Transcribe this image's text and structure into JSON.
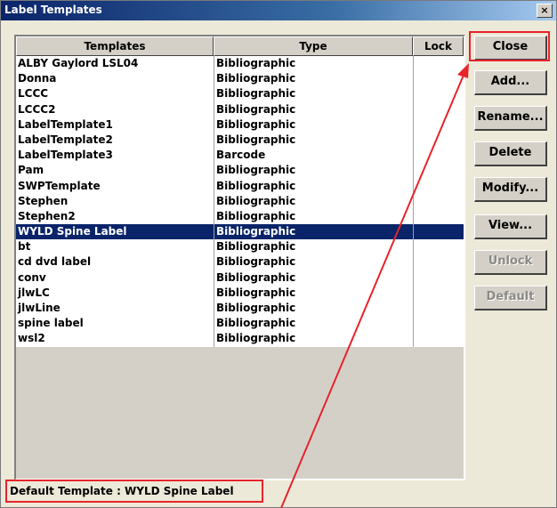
{
  "window": {
    "title": "Label Templates",
    "close_glyph": "×"
  },
  "table": {
    "columns": [
      "Templates",
      "Type",
      "Lock"
    ],
    "rows": [
      {
        "template": "ALBY Gaylord LSL04",
        "type": "Bibliographic",
        "lock": ""
      },
      {
        "template": "Donna",
        "type": "Bibliographic",
        "lock": ""
      },
      {
        "template": "LCCC",
        "type": "Bibliographic",
        "lock": ""
      },
      {
        "template": "LCCC2",
        "type": "Bibliographic",
        "lock": ""
      },
      {
        "template": "LabelTemplate1",
        "type": "Bibliographic",
        "lock": ""
      },
      {
        "template": "LabelTemplate2",
        "type": "Bibliographic",
        "lock": ""
      },
      {
        "template": "LabelTemplate3",
        "type": "Barcode",
        "lock": ""
      },
      {
        "template": "Pam",
        "type": "Bibliographic",
        "lock": ""
      },
      {
        "template": "SWPTemplate",
        "type": "Bibliographic",
        "lock": ""
      },
      {
        "template": "Stephen",
        "type": "Bibliographic",
        "lock": ""
      },
      {
        "template": "Stephen2",
        "type": "Bibliographic",
        "lock": ""
      },
      {
        "template": "WYLD Spine Label",
        "type": "Bibliographic",
        "lock": "",
        "selected": true
      },
      {
        "template": "bt",
        "type": "Bibliographic",
        "lock": ""
      },
      {
        "template": "cd dvd label",
        "type": "Bibliographic",
        "lock": ""
      },
      {
        "template": "conv",
        "type": "Bibliographic",
        "lock": ""
      },
      {
        "template": "jlwLC",
        "type": "Bibliographic",
        "lock": ""
      },
      {
        "template": "jlwLine",
        "type": "Bibliographic",
        "lock": ""
      },
      {
        "template": "spine label",
        "type": "Bibliographic",
        "lock": ""
      },
      {
        "template": "wsl2",
        "type": "Bibliographic",
        "lock": ""
      }
    ]
  },
  "status": {
    "default_template": "Default Template : WYLD Spine Label"
  },
  "buttons": [
    {
      "label": "Close",
      "enabled": true,
      "highlighted": true
    },
    {
      "label": "Add...",
      "enabled": true
    },
    {
      "label": "Rename...",
      "enabled": true
    },
    {
      "label": "Delete",
      "enabled": true
    },
    {
      "label": "Modify...",
      "enabled": true
    },
    {
      "label": "View...",
      "enabled": true
    },
    {
      "label": "Unlock",
      "enabled": false
    },
    {
      "label": "Default",
      "enabled": false
    }
  ],
  "colors": {
    "selection": "#0a246a",
    "annotation": "#e8232a",
    "dialog_face": "#d4d0c8"
  }
}
